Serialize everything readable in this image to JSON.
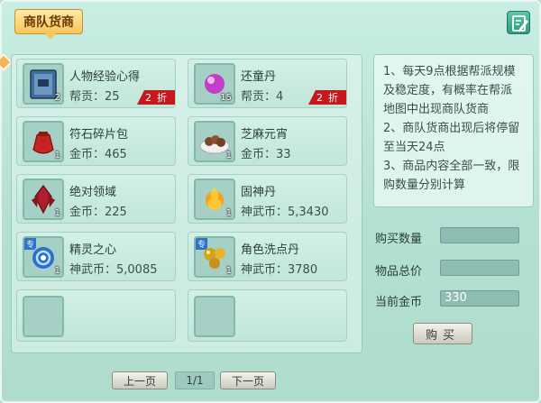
{
  "title": "商队货商",
  "items": [
    {
      "name": "人物经验心得",
      "price": "帮贡：25",
      "count": "2",
      "discount_num": "2",
      "discount_unit": "折",
      "icon": "book-icon"
    },
    {
      "name": "还童丹",
      "price": "帮贡：4",
      "count": "15",
      "discount_num": "2",
      "discount_unit": "折",
      "icon": "purple-pill-icon"
    },
    {
      "name": "符石碎片包",
      "price": "金币：465",
      "count": "1",
      "icon": "red-pouch-icon"
    },
    {
      "name": "芝麻元宵",
      "price": "金币：33",
      "count": "1",
      "icon": "dumpling-plate-icon"
    },
    {
      "name": "绝对领域",
      "price": "金币：225",
      "count": "1",
      "icon": "red-crystal-icon"
    },
    {
      "name": "固神丹",
      "price": "神武币：5,3430",
      "count": "1",
      "icon": "fire-orb-icon"
    },
    {
      "name": "精灵之心",
      "price": "神武币：5,0085",
      "count": "1",
      "tag": "专",
      "icon": "blue-swirl-icon"
    },
    {
      "name": "角色洗点丹",
      "price": "神武币：3780",
      "count": "1",
      "tag": "专",
      "icon": "gold-pills-icon"
    }
  ],
  "info": {
    "lines": [
      "1、每天9点根据帮派规模",
      "及稳定度，有概率在帮派",
      "地图中出现商队货商",
      "2、商队货商出现后将停留",
      "至当天24点",
      "3、商品内容全部一致，限",
      "购数量分别计算"
    ]
  },
  "form": {
    "qty_label": "购买数量",
    "qty_value": "",
    "total_label": "物品总价",
    "total_value": "",
    "gold_label": "当前金币",
    "gold_value": "330"
  },
  "buy_label": "购买",
  "pager": {
    "prev": "上一页",
    "page": "1/1",
    "next": "下一页"
  },
  "colors": {
    "panel_bg": "#c9eee4",
    "discount_red": "#c6171d",
    "title_gold": "#f7c65a"
  }
}
